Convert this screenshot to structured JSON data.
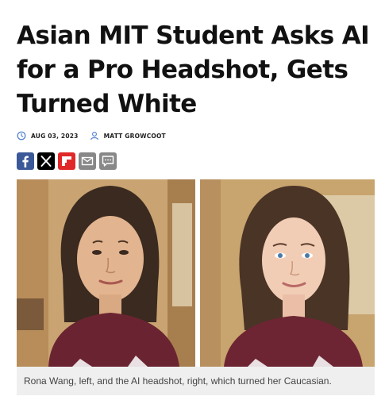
{
  "article": {
    "headline": "Asian MIT Student Asks AI for a Pro Headshot, Gets Turned White",
    "date": "AUG 03, 2023",
    "author": "MATT GROWCOOT",
    "caption": "Rona Wang, left, and the AI headshot, right, which turned her Caucasian."
  },
  "share_buttons": [
    {
      "icon": "facebook-icon",
      "color": "#3b5998"
    },
    {
      "icon": "x-icon",
      "color": "#000000"
    },
    {
      "icon": "flipboard-icon",
      "color": "#e12828"
    },
    {
      "icon": "email-icon",
      "color": "#888888"
    },
    {
      "icon": "comment-icon",
      "color": "#888888"
    }
  ],
  "colors": {
    "text": "#111111",
    "meta_icon": "#4a7bd0",
    "caption_bg": "#efefef"
  }
}
